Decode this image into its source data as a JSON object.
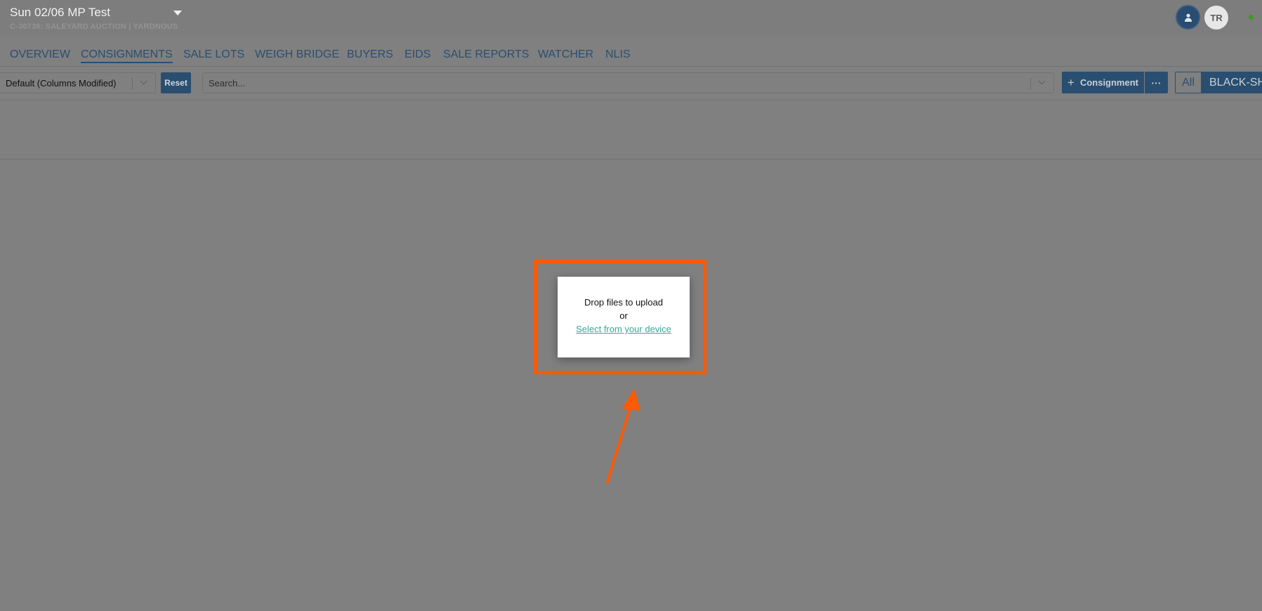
{
  "header": {
    "sale_title": "Sun 02/06 MP Test",
    "sale_subtitle": "C-30736: SALEYARD AUCTION | YARDNOUS",
    "user_avatar_initials": "TR",
    "icons": {
      "sale_dropdown": "caret-down-icon",
      "user_menu": "user-icon",
      "status": "online-status-dot"
    },
    "colors": {
      "brand": "#2a4e70",
      "status_online": "#3c9a23"
    }
  },
  "tabs": [
    {
      "label": "OVERVIEW",
      "active": false
    },
    {
      "label": "CONSIGNMENTS",
      "active": true
    },
    {
      "label": "SALE LOTS",
      "active": false
    },
    {
      "label": "WEIGH BRIDGE",
      "active": false
    },
    {
      "label": "BUYERS",
      "active": false
    },
    {
      "label": "EIDS",
      "active": false
    },
    {
      "label": "SALE REPORTS",
      "active": false
    },
    {
      "label": "WATCHER",
      "active": false
    },
    {
      "label": "NLIS",
      "active": false
    }
  ],
  "toolbar": {
    "view_selected": "Default (Columns Modified)",
    "reset_label": "Reset",
    "search_placeholder": "Search...",
    "add_consignment_label": "Consignment",
    "more_label": "···",
    "filter_all_label": "All",
    "filter_species_label": "BLACK-SHEEP"
  },
  "upload_dialog": {
    "drop_text": "Drop files to upload",
    "or_text": "or",
    "select_link": "Select from your device",
    "link_color": "#39a89a",
    "annotation_color": "#fb5a06"
  }
}
